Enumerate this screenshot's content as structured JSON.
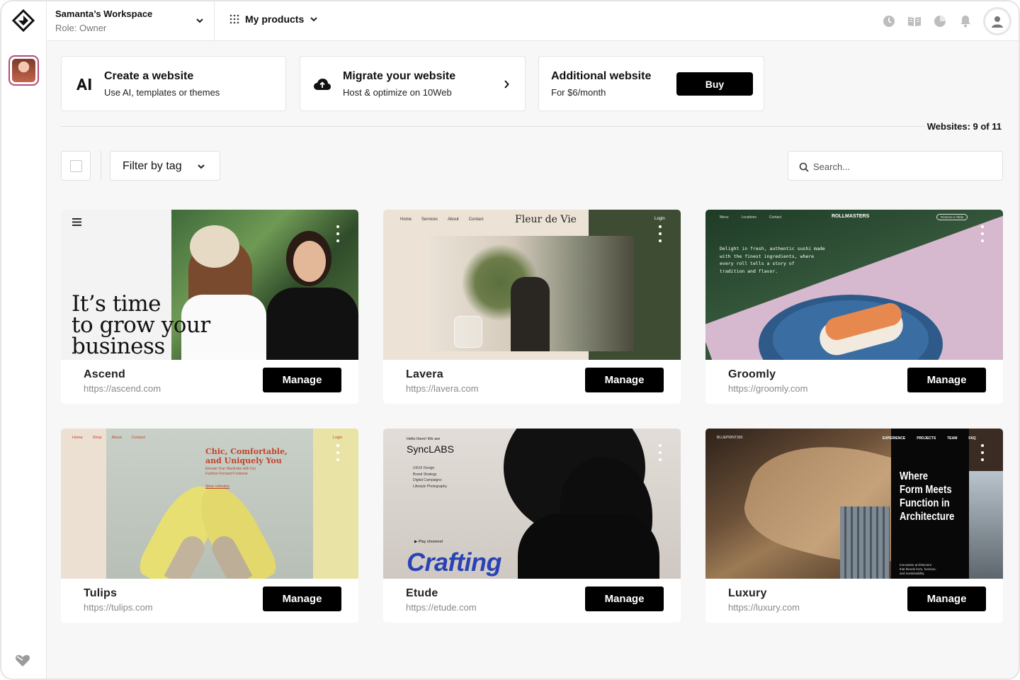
{
  "workspace": {
    "name": "Samanta’s Workspace",
    "role": "Role: Owner"
  },
  "topbar": {
    "products_label": "My products"
  },
  "actions": [
    {
      "icon": "ai-icon",
      "title": "Create a website",
      "subtitle": "Use AI, templates or themes"
    },
    {
      "icon": "cloud-upload-icon",
      "title": "Migrate your website",
      "subtitle": "Host & optimize on 10Web"
    },
    {
      "title": "Additional website",
      "subtitle": "For $6/month",
      "button": "Buy"
    }
  ],
  "websites_count": "Websites: 9 of 11",
  "filter": {
    "label": "Filter by tag"
  },
  "search": {
    "placeholder": "Search..."
  },
  "manage_label": "Manage",
  "sites": [
    {
      "name": "Ascend",
      "url": "https://ascend.com",
      "thumb": {
        "headline": [
          "It’s time",
          "to grow your",
          "business"
        ]
      }
    },
    {
      "name": "Lavera",
      "url": "https://lavera.com",
      "thumb": {
        "nav": [
          "Home",
          "Services",
          "About",
          "Contact"
        ],
        "brand": "Fleur de Vie",
        "login": "Login"
      }
    },
    {
      "name": "Groomly",
      "url": "https://groomly.com",
      "thumb": {
        "nav": [
          "Menu",
          "Locations",
          "Contact"
        ],
        "brand": "ROLLMASTERS",
        "cta": "Reserve a Table",
        "text": [
          "Delight in fresh, authentic sushi made",
          "with the finest ingredients, where",
          "every roll tells a story of",
          "tradition and flavor."
        ]
      }
    },
    {
      "name": "Tulips",
      "url": "https://tulips.com",
      "thumb": {
        "nav": [
          "Home",
          "Shop",
          "About",
          "Contact"
        ],
        "login": "Login",
        "headline": [
          "Chic, Comfortable,",
          "and Uniquely You"
        ],
        "sub": [
          "Elevate Your Wardrobe with Our",
          "Fashion-Forward Footwear"
        ],
        "link": "Shop collection"
      }
    },
    {
      "name": "Etude",
      "url": "https://etude.com",
      "thumb": {
        "greeting": "Hello there! We are",
        "brand": "SyncLABS",
        "services": [
          "UI/UX Design",
          "Brand Strategy",
          "Digital Campaigns",
          "Lifestyle Photography"
        ],
        "play": "Play showreel",
        "headline": "Crafting"
      }
    },
    {
      "name": "Luxury",
      "url": "https://luxury.com",
      "thumb": {
        "brand": "BLUEPRINT360",
        "nav": [
          "EXPERIENCE",
          "PROJECTS",
          "TEAM",
          "FAQ"
        ],
        "headline": [
          "Where",
          "Form Meets",
          "Function in",
          "Architecture"
        ],
        "sub": [
          "Innovative architecture",
          "that blends form, function,",
          "and sustainability."
        ]
      }
    }
  ]
}
